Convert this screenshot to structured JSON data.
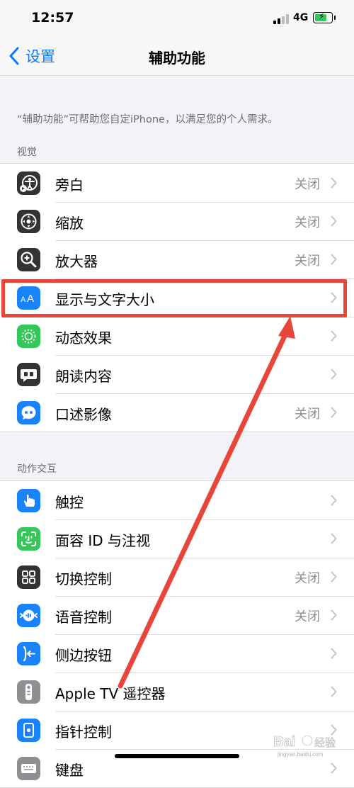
{
  "status_bar": {
    "time": "12:57",
    "network": "4G"
  },
  "nav": {
    "back_label": "设置",
    "title": "辅助功能"
  },
  "description": "“辅助功能”可帮助您自定iPhone，以满足您的个人需求。",
  "sections": [
    {
      "header": "视觉",
      "rows": [
        {
          "label": "旁白",
          "value": "关闭",
          "icon": "voiceover-icon"
        },
        {
          "label": "缩放",
          "value": "关闭",
          "icon": "zoom-icon"
        },
        {
          "label": "放大器",
          "value": "关闭",
          "icon": "magnifier-icon"
        },
        {
          "label": "显示与文字大小",
          "value": "",
          "icon": "text-size-icon"
        },
        {
          "label": "动态效果",
          "value": "",
          "icon": "motion-icon"
        },
        {
          "label": "朗读内容",
          "value": "",
          "icon": "spoken-content-icon"
        },
        {
          "label": "口述影像",
          "value": "关闭",
          "icon": "audio-description-icon"
        }
      ]
    },
    {
      "header": "动作交互",
      "rows": [
        {
          "label": "触控",
          "value": "",
          "icon": "touch-icon"
        },
        {
          "label": "面容 ID 与注视",
          "value": "",
          "icon": "face-id-icon"
        },
        {
          "label": "切换控制",
          "value": "关闭",
          "icon": "switch-control-icon"
        },
        {
          "label": "语音控制",
          "value": "关闭",
          "icon": "voice-control-icon"
        },
        {
          "label": "侧边按钮",
          "value": "",
          "icon": "side-button-icon"
        },
        {
          "label": "Apple TV 遥控器",
          "value": "",
          "icon": "tv-remote-icon"
        },
        {
          "label": "指针控制",
          "value": "",
          "icon": "pointer-control-icon"
        },
        {
          "label": "键盘",
          "value": "",
          "icon": "keyboard-icon"
        }
      ]
    }
  ],
  "colors": {
    "accent": "#0a7aff",
    "annotation": "#e7463a",
    "icon_blue": "#1a82fb",
    "icon_gray": "#333336",
    "icon_green": "#34c759",
    "icon_light_gray": "#8e8e93"
  }
}
